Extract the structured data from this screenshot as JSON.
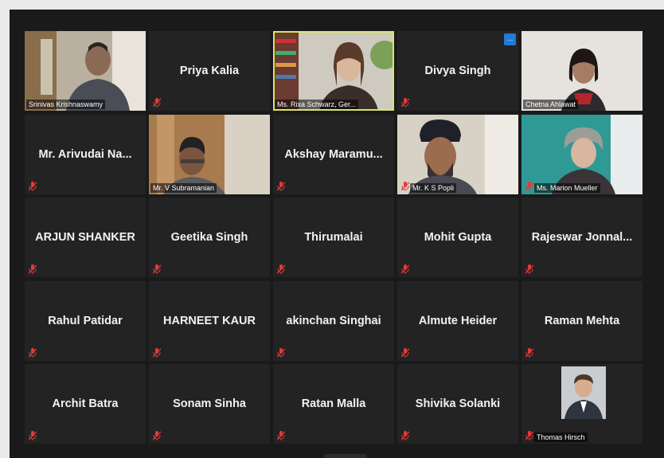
{
  "participants": [
    {
      "id": "p1",
      "name": "Srinivas Krishnaswamy",
      "video": true,
      "speaking": false,
      "mic_muted": false
    },
    {
      "id": "p2",
      "name": "Priya Kalia",
      "video": false,
      "mic_muted": true
    },
    {
      "id": "p3",
      "name": "Ms. Rixa Schwarz, Ger...",
      "video": true,
      "speaking": true,
      "mic_muted": false
    },
    {
      "id": "p4",
      "name": "Divya Singh",
      "video": false,
      "mic_muted": true,
      "has_more_button": true,
      "more_label": "..."
    },
    {
      "id": "p5",
      "name": "Chetna Ahlawat",
      "video": true,
      "mic_muted": false
    },
    {
      "id": "p6",
      "name": "Mr. Arivudai Na...",
      "video": false,
      "mic_muted": true
    },
    {
      "id": "p7",
      "name": "Mr. V Subramanian",
      "video": true,
      "mic_muted": false
    },
    {
      "id": "p8",
      "name": "Akshay  Maramu...",
      "video": false,
      "mic_muted": true
    },
    {
      "id": "p9",
      "name": "Mr. K S Popli",
      "video": true,
      "mic_muted": true
    },
    {
      "id": "p10",
      "name": "Ms. Marion Mueller",
      "video": true,
      "mic_muted": true
    },
    {
      "id": "p11",
      "name": "ARJUN SHANKER",
      "video": false,
      "mic_muted": true
    },
    {
      "id": "p12",
      "name": "Geetika Singh",
      "video": false,
      "mic_muted": true
    },
    {
      "id": "p13",
      "name": "Thirumalai",
      "video": false,
      "mic_muted": true
    },
    {
      "id": "p14",
      "name": "Mohit Gupta",
      "video": false,
      "mic_muted": true
    },
    {
      "id": "p15",
      "name": "Rajeswar  Jonnal...",
      "video": false,
      "mic_muted": true
    },
    {
      "id": "p16",
      "name": "Rahul Patidar",
      "video": false,
      "mic_muted": true
    },
    {
      "id": "p17",
      "name": "HARNEET KAUR",
      "video": false,
      "mic_muted": true
    },
    {
      "id": "p18",
      "name": "akinchan Singhai",
      "video": false,
      "mic_muted": true
    },
    {
      "id": "p19",
      "name": "Almute Heider",
      "video": false,
      "mic_muted": true
    },
    {
      "id": "p20",
      "name": "Raman Mehta",
      "video": false,
      "mic_muted": true
    },
    {
      "id": "p21",
      "name": "Archit Batra",
      "video": false,
      "mic_muted": true
    },
    {
      "id": "p22",
      "name": "Sonam Sinha",
      "video": false,
      "mic_muted": true
    },
    {
      "id": "p23",
      "name": "Ratan Malla",
      "video": false,
      "mic_muted": true
    },
    {
      "id": "p24",
      "name": "Shivika Solanki",
      "video": false,
      "mic_muted": true
    },
    {
      "id": "p25",
      "name": "Thomas Hirsch",
      "video": false,
      "profile_photo": true,
      "mic_muted": true
    }
  ],
  "colors": {
    "speaker_highlight": "#d7e56a",
    "muted_icon": "#e53935",
    "more_button": "#1f7bd8",
    "tile_bg": "#232323"
  }
}
